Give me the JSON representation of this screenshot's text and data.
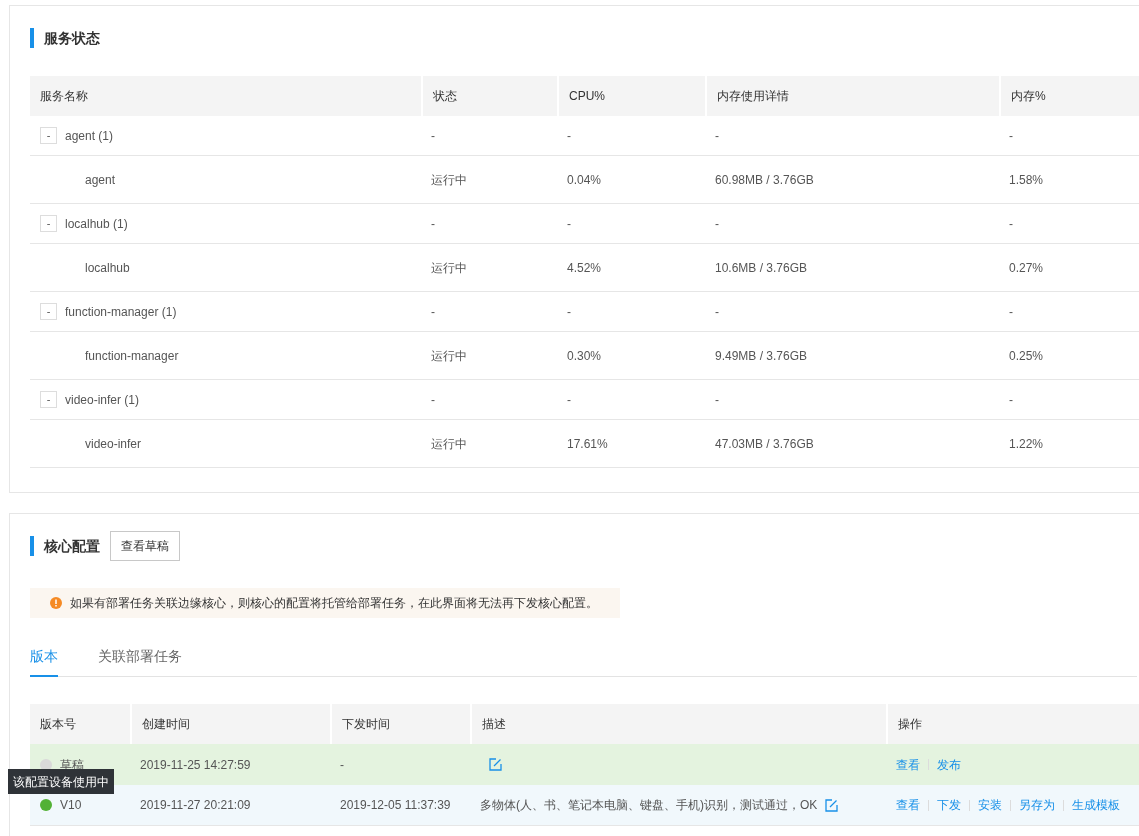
{
  "service_status": {
    "title": "服务状态",
    "table": {
      "columns": [
        "服务名称",
        "状态",
        "CPU%",
        "内存使用详情",
        "内存%"
      ],
      "rows": [
        {
          "name": "agent (1)",
          "toggle": "-",
          "status": "-",
          "cpu": "-",
          "memory": "-",
          "memory_pct": "-",
          "children": [
            {
              "name": "agent",
              "status": "运行中",
              "cpu": "0.04%",
              "memory": "60.98MB / 3.76GB",
              "memory_pct": "1.58%"
            }
          ]
        },
        {
          "name": "localhub (1)",
          "toggle": "-",
          "status": "-",
          "cpu": "-",
          "memory": "-",
          "memory_pct": "-",
          "children": [
            {
              "name": "localhub",
              "status": "运行中",
              "cpu": "4.52%",
              "memory": "10.6MB / 3.76GB",
              "memory_pct": "0.27%"
            }
          ]
        },
        {
          "name": "function-manager (1)",
          "toggle": "-",
          "status": "-",
          "cpu": "-",
          "memory": "-",
          "memory_pct": "-",
          "children": [
            {
              "name": "function-manager",
              "status": "运行中",
              "cpu": "0.30%",
              "memory": "9.49MB / 3.76GB",
              "memory_pct": "0.25%"
            }
          ]
        },
        {
          "name": "video-infer (1)",
          "toggle": "-",
          "status": "-",
          "cpu": "-",
          "memory": "-",
          "memory_pct": "-",
          "children": [
            {
              "name": "video-infer",
              "status": "运行中",
              "cpu": "17.61%",
              "memory": "47.03MB / 3.76GB",
              "memory_pct": "1.22%"
            }
          ]
        }
      ]
    }
  },
  "core_config": {
    "title": "核心配置",
    "view_draft_button": "查看草稿",
    "notice": "如果有部署任务关联边缘核心，则核心的配置将托管给部署任务，在此界面将无法再下发核心配置。",
    "tabs": [
      {
        "label": "版本",
        "selected": true
      },
      {
        "label": "关联部署任务",
        "selected": false
      }
    ],
    "table": {
      "columns": [
        "版本号",
        "创建时间",
        "下发时间",
        "描述",
        "操作"
      ],
      "rows": [
        {
          "kind": "draft",
          "color": "#d9d9d9",
          "version": "草稿",
          "created": "2019-11-25 14:27:59",
          "issued": "-",
          "description": "",
          "actions": [
            "查看",
            "发布"
          ]
        },
        {
          "kind": "hovered",
          "color": "#52b135",
          "version": "V10",
          "created": "2019-11-27 20:21:09",
          "issued": "2019-12-05 11:37:39",
          "description": "多物体(人、书、笔记本电脑、键盘、手机)识别，测试通过，OK",
          "actions": [
            "查看",
            "下发",
            "安装",
            "另存为",
            "生成模板"
          ]
        }
      ]
    },
    "tooltip": "该配置设备使用中"
  }
}
